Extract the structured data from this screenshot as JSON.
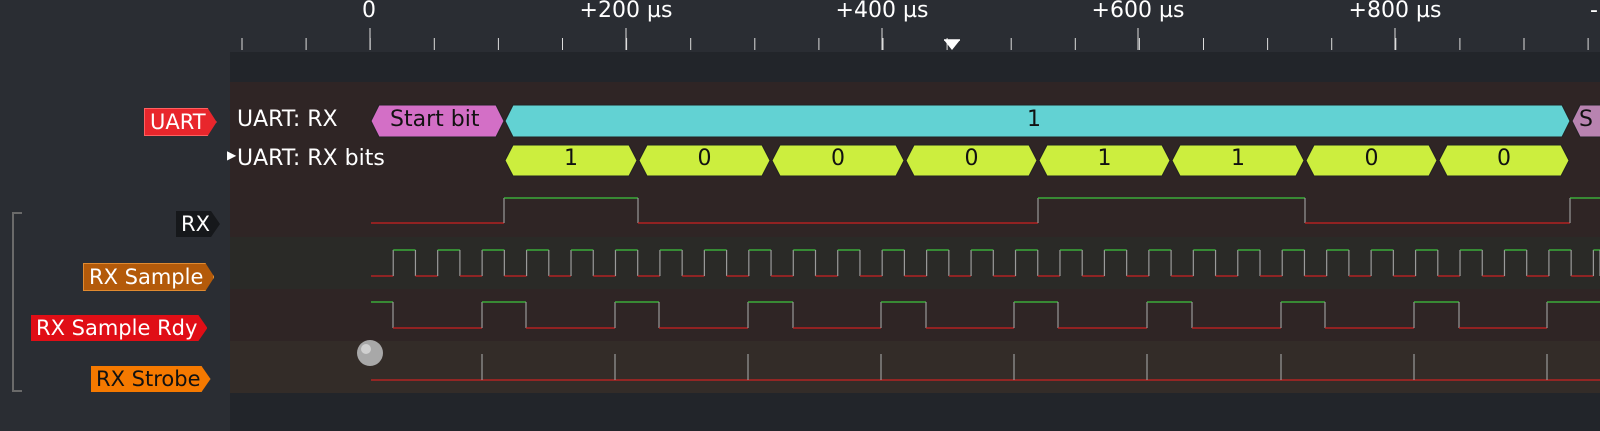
{
  "ruler": {
    "ticks": [
      "0",
      "+200 µs",
      "+400 µs",
      "+600 µs",
      "+800 µs"
    ],
    "edge_glyph": "-"
  },
  "decoder": {
    "tag_label": "UART",
    "row_rx_label": "UART: RX",
    "row_bits_label": "UART: RX bits",
    "start_bit_label": "Start bit",
    "data_label": "1",
    "next_label": "S",
    "bits": [
      "1",
      "0",
      "0",
      "0",
      "1",
      "1",
      "0",
      "0"
    ]
  },
  "channels": [
    {
      "name": "RX",
      "color": "#16181b"
    },
    {
      "name": "RX Sample",
      "color": "#b35a0a"
    },
    {
      "name": "RX Sample Rdy",
      "color": "#e00e16"
    },
    {
      "name": "RX Strobe",
      "color": "#f57900"
    }
  ],
  "colors": {
    "start_bit": "#d36fc6",
    "data_byte": "#62d2d3",
    "bit_cell": "#ccee3e",
    "trace_high": "#3ec53e",
    "trace_low": "#cc2222",
    "edge": "#9a9a9a"
  }
}
